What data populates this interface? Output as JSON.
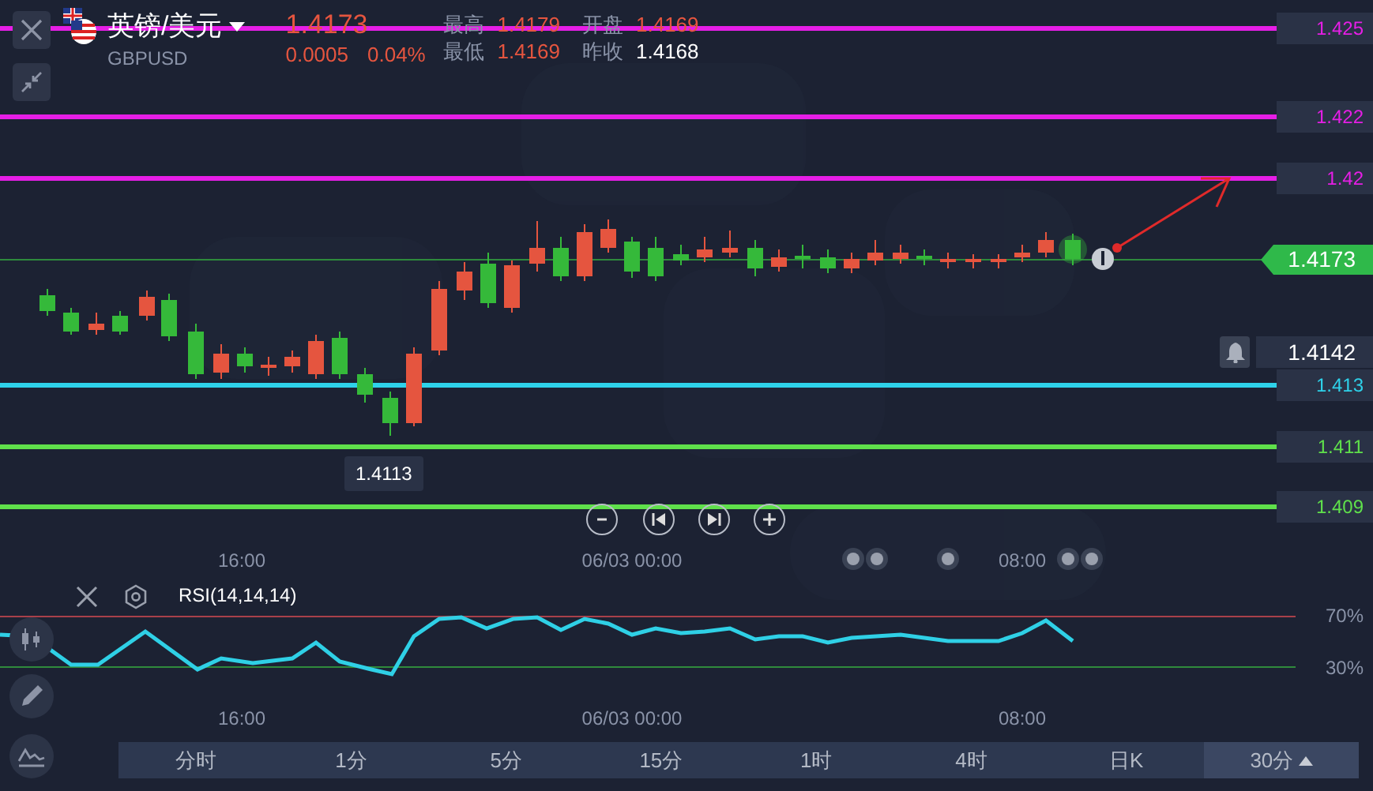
{
  "symbol": {
    "name": "英镑/美元",
    "code": "GBPUSD",
    "price": "1.4173",
    "change": "0.0005",
    "change_pct": "0.04%"
  },
  "stats": [
    {
      "label": "最高",
      "value": "1.4179",
      "kind": "up"
    },
    {
      "label": "开盘",
      "value": "1.4169",
      "kind": "up"
    },
    {
      "label": "最低",
      "value": "1.4169",
      "kind": "up"
    },
    {
      "label": "昨收",
      "value": "1.4168",
      "kind": "flat"
    }
  ],
  "level_lines": [
    {
      "label": "1.425",
      "color": "#e61ee6"
    },
    {
      "label": "1.422",
      "color": "#e61ee6"
    },
    {
      "label": "1.42",
      "color": "#e61ee6"
    },
    {
      "label": "1.413",
      "color": "#2ed2ea"
    },
    {
      "label": "1.411",
      "color": "#5fe04b"
    },
    {
      "label": "1.409",
      "color": "#5fe04b"
    }
  ],
  "current_price": "1.4173",
  "alert_price": "1.4142",
  "low_marker": "1.4113",
  "time_labels": [
    "16:00",
    "06/03 00:00",
    "08:00"
  ],
  "indicator": {
    "name": "RSI(14,14,14)",
    "levels": [
      "70%",
      "30%"
    ],
    "time_labels": [
      "16:00",
      "06/03 00:00",
      "08:00"
    ]
  },
  "timeframes": [
    {
      "label": "分时",
      "selected": false
    },
    {
      "label": "1分",
      "selected": false
    },
    {
      "label": "5分",
      "selected": false
    },
    {
      "label": "15分",
      "selected": false
    },
    {
      "label": "1时",
      "selected": false
    },
    {
      "label": "4时",
      "selected": false
    },
    {
      "label": "日K",
      "selected": false
    },
    {
      "label": "30分",
      "selected": true
    }
  ]
}
